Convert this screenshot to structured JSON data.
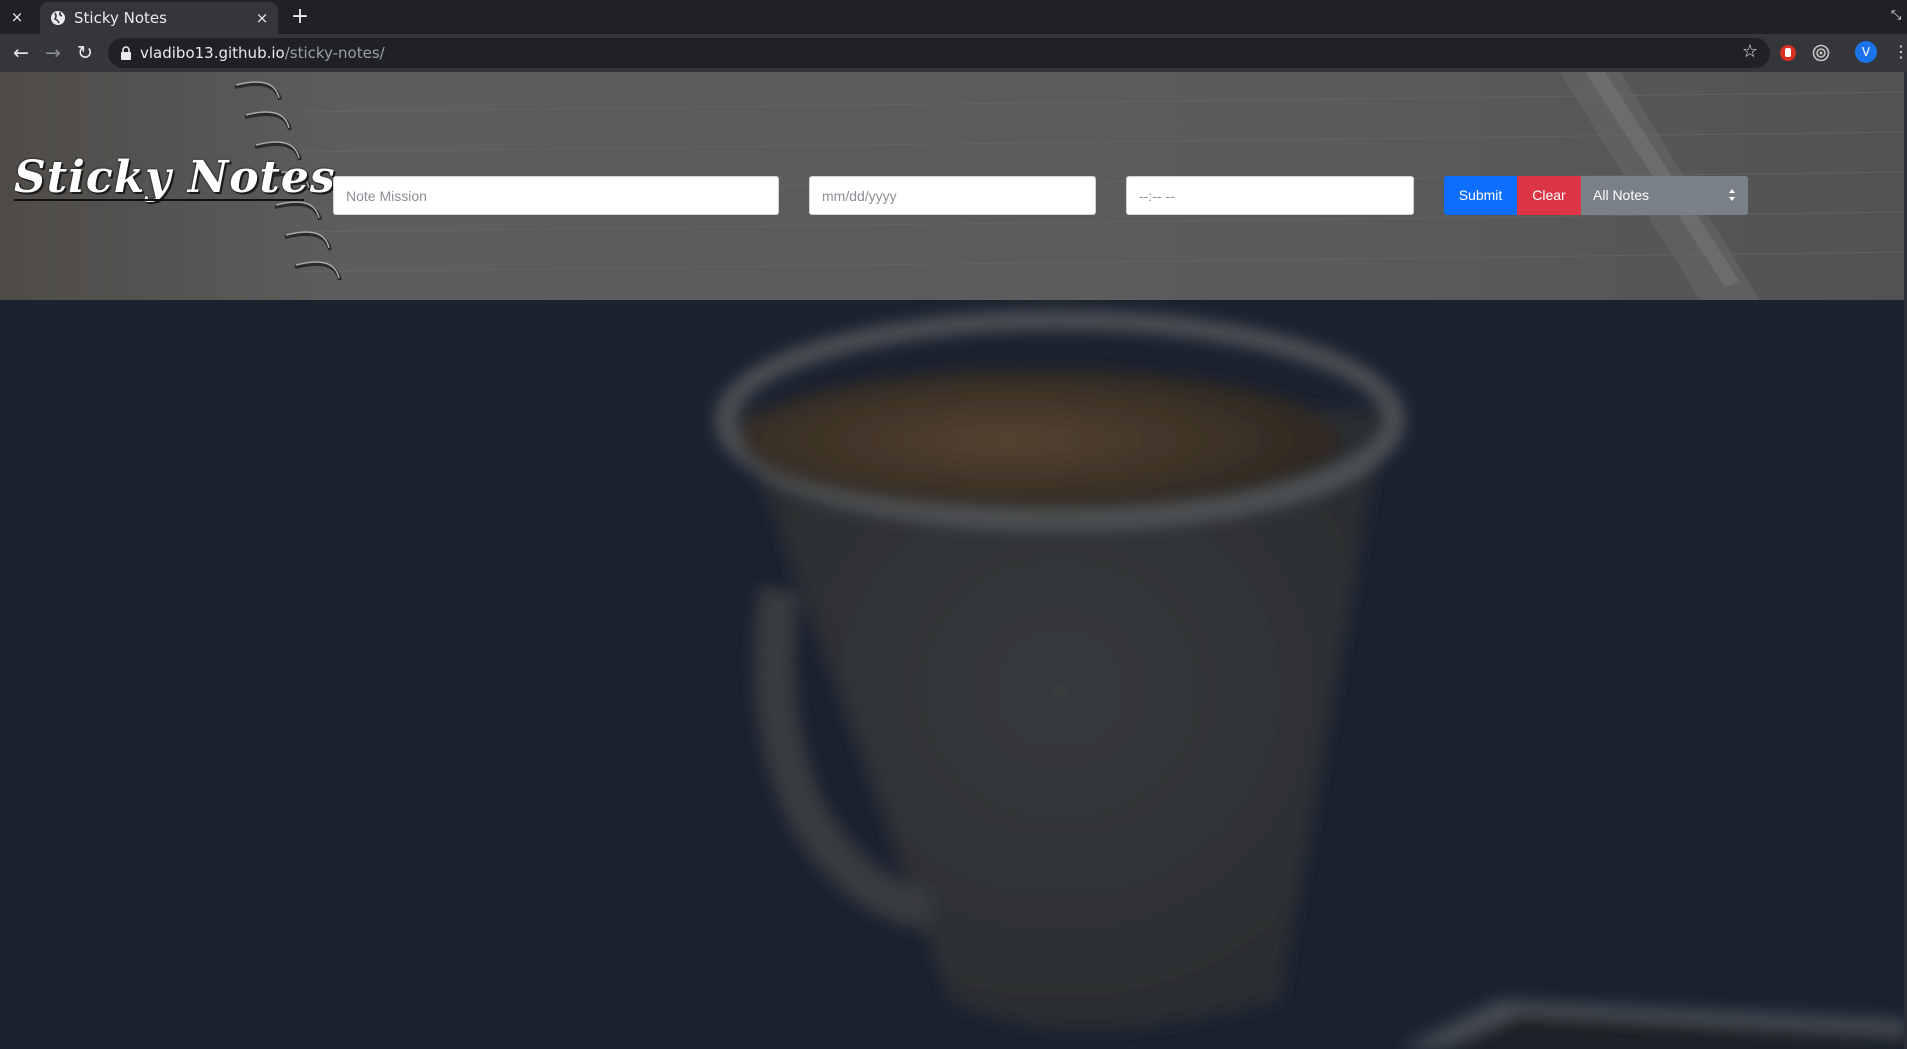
{
  "browser": {
    "tab_title": "Sticky Notes",
    "url_host": "vladibo13.github.io",
    "url_path": "/sticky-notes/",
    "profile_initial": "V",
    "close_glyph": "×",
    "new_tab_glyph": "+",
    "back_glyph": "←",
    "forward_glyph": "→",
    "reload_glyph": "↻",
    "star_glyph": "☆",
    "menu_glyph": "⋮"
  },
  "app": {
    "logo_text": "Sticky Notes",
    "note_input": {
      "placeholder": "Note Mission"
    },
    "date_input": {
      "placeholder": "mm/dd/yyyy"
    },
    "time_input": {
      "placeholder": "--:-- --"
    },
    "submit_label": "Submit",
    "clear_label": "Clear",
    "filter_select": {
      "selected": "All Notes"
    }
  },
  "colors": {
    "submit": "#0d6efd",
    "clear": "#dc3545",
    "select": "#7a8087"
  }
}
